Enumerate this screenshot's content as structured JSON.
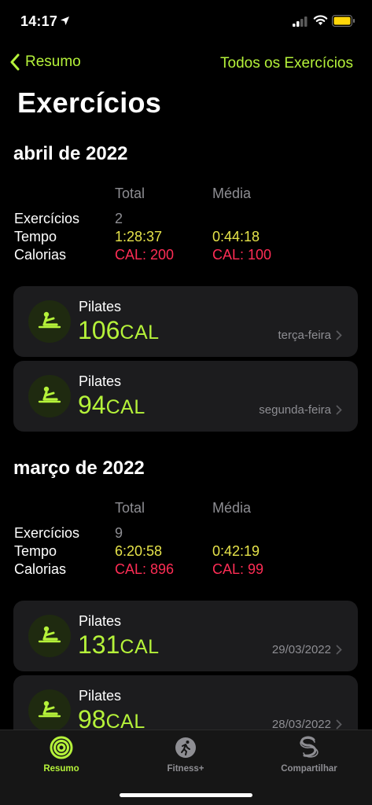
{
  "status": {
    "time": "14:17"
  },
  "nav": {
    "back_label": "Resumo",
    "right_label": "Todos os Exercícios"
  },
  "title": "Exercícios",
  "months": [
    {
      "title": "abril de 2022",
      "header_total": "Total",
      "header_avg": "Média",
      "rows": [
        {
          "label": "Exercícios",
          "total": "2",
          "avg": ""
        },
        {
          "label": "Tempo",
          "total": "1:28:37",
          "avg": "0:44:18"
        },
        {
          "label": "Calorias",
          "total": "CAL: 200",
          "avg": "CAL: 100"
        }
      ],
      "workouts": [
        {
          "name": "Pilates",
          "value": "106",
          "unit": "CAL",
          "date": "terça-feira"
        },
        {
          "name": "Pilates",
          "value": "94",
          "unit": "CAL",
          "date": "segunda-feira"
        }
      ]
    },
    {
      "title": "março de 2022",
      "header_total": "Total",
      "header_avg": "Média",
      "rows": [
        {
          "label": "Exercícios",
          "total": "9",
          "avg": ""
        },
        {
          "label": "Tempo",
          "total": "6:20:58",
          "avg": "0:42:19"
        },
        {
          "label": "Calorias",
          "total": "CAL: 896",
          "avg": "CAL: 99"
        }
      ],
      "workouts": [
        {
          "name": "Pilates",
          "value": "131",
          "unit": "CAL",
          "date": "29/03/2022"
        },
        {
          "name": "Pilates",
          "value": "98",
          "unit": "CAL",
          "date": "28/03/2022"
        }
      ]
    }
  ],
  "tabs": [
    {
      "label": "Resumo",
      "icon": "activity-rings-icon",
      "active": true
    },
    {
      "label": "Fitness+",
      "icon": "runner-icon",
      "active": false
    },
    {
      "label": "Compartilhar",
      "icon": "sharing-icon",
      "active": false
    }
  ],
  "colors": {
    "accent": "#b5f23a",
    "time": "#e6e34a",
    "calories": "#ff2d55",
    "card": "#1c1c1e"
  }
}
